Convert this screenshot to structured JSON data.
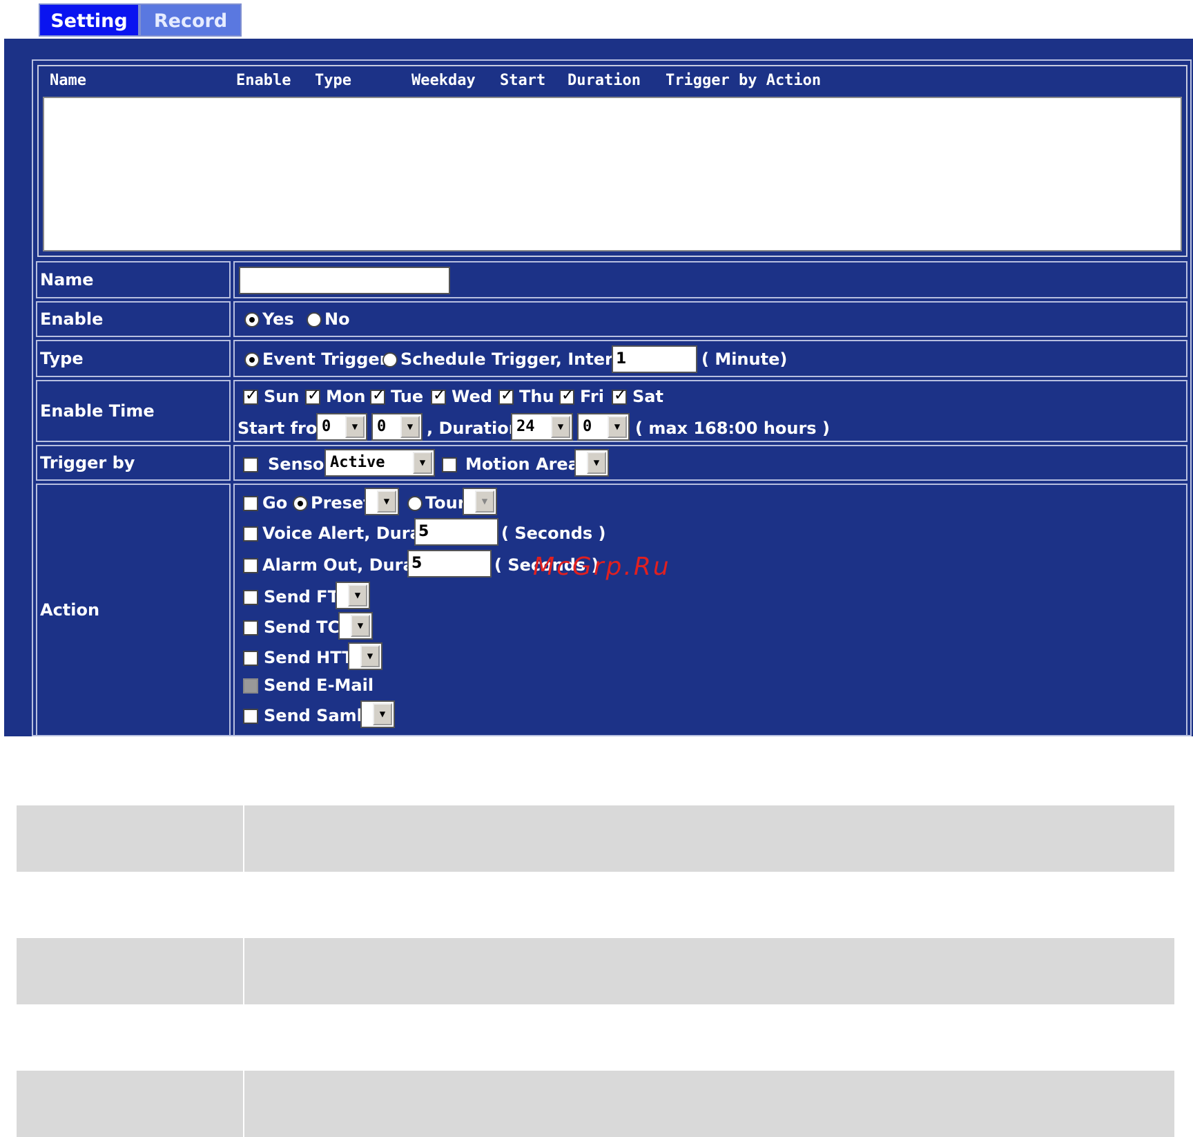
{
  "tabs": {
    "setting": "Setting",
    "record": "Record"
  },
  "list": {
    "columns": {
      "name": "Name",
      "enable": "Enable",
      "type": "Type",
      "weekday": "Weekday",
      "start": "Start",
      "duration": "Duration",
      "trigger": "Trigger by Action"
    }
  },
  "form": {
    "name": {
      "label": "Name",
      "value": ""
    },
    "enable": {
      "label": "Enable",
      "yes": "Yes",
      "no": "No"
    },
    "type": {
      "label": "Type",
      "event": "Event Trigger",
      "schedule": "Schedule Trigger, Interval",
      "interval": "1",
      "unit": "( Minute)"
    },
    "enable_time": {
      "label": "Enable Time",
      "days": [
        "Sun",
        "Mon",
        "Tue",
        "Wed",
        "Thu",
        "Fri",
        "Sat"
      ],
      "start_from": "Start from",
      "start_h": "0",
      "start_m": "0",
      "duration": ", Duration",
      "dur_h": "24",
      "dur_m": "0",
      "max": "( max 168:00 hours )"
    },
    "trigger": {
      "label": "Trigger by",
      "sensor": "Sensor",
      "sensor_value": "Active",
      "motion": "Motion Area"
    },
    "action": {
      "label": "Action",
      "go": "Go",
      "preset": "Preset",
      "tour": "Tour",
      "voice": "Voice Alert, Duration",
      "voice_value": "5",
      "voice_unit": "( Seconds )",
      "alarm": "Alarm Out, Duration",
      "alarm_value": "5",
      "alarm_unit": "( Seconds )",
      "ftp": "Send FTP",
      "tcp": "Send TCP",
      "http": "Send HTTP",
      "email": "Send E-Mail",
      "samba": "Send Samba"
    }
  },
  "watermark": "McGrp.Ru"
}
